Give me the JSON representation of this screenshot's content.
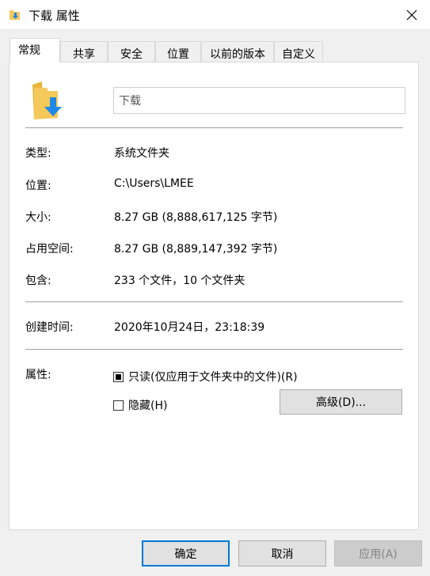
{
  "window": {
    "title": "下载 属性",
    "close_icon": "close-icon"
  },
  "tabs": [
    {
      "label": "常规",
      "active": true
    },
    {
      "label": "共享"
    },
    {
      "label": "安全"
    },
    {
      "label": "位置"
    },
    {
      "label": "以前的版本"
    },
    {
      "label": "自定义"
    }
  ],
  "general": {
    "name_value": "下载",
    "type_label": "类型:",
    "type_value": "系统文件夹",
    "location_label": "位置:",
    "location_value": "C:\\Users\\LMEE",
    "size_label": "大小:",
    "size_value": "8.27 GB (8,888,617,125 字节)",
    "disk_label": "占用空间:",
    "disk_value": "8.27 GB (8,889,147,392 字节)",
    "contains_label": "包含:",
    "contains_value": "233 个文件，10 个文件夹",
    "created_label": "创建时间:",
    "created_value": "2020年10月24日，23:18:39",
    "attributes_label": "属性:",
    "readonly_label": "只读(仅应用于文件夹中的文件)(R)",
    "readonly_state": "indeterminate",
    "hidden_label": "隐藏(H)",
    "hidden_checked": false,
    "advanced_label": "高级(D)..."
  },
  "footer": {
    "ok_label": "确定",
    "cancel_label": "取消",
    "apply_label": "应用(A)"
  },
  "colors": {
    "accent": "#0078d7",
    "folder": "#f5c85a",
    "arrow": "#1e88e5"
  }
}
